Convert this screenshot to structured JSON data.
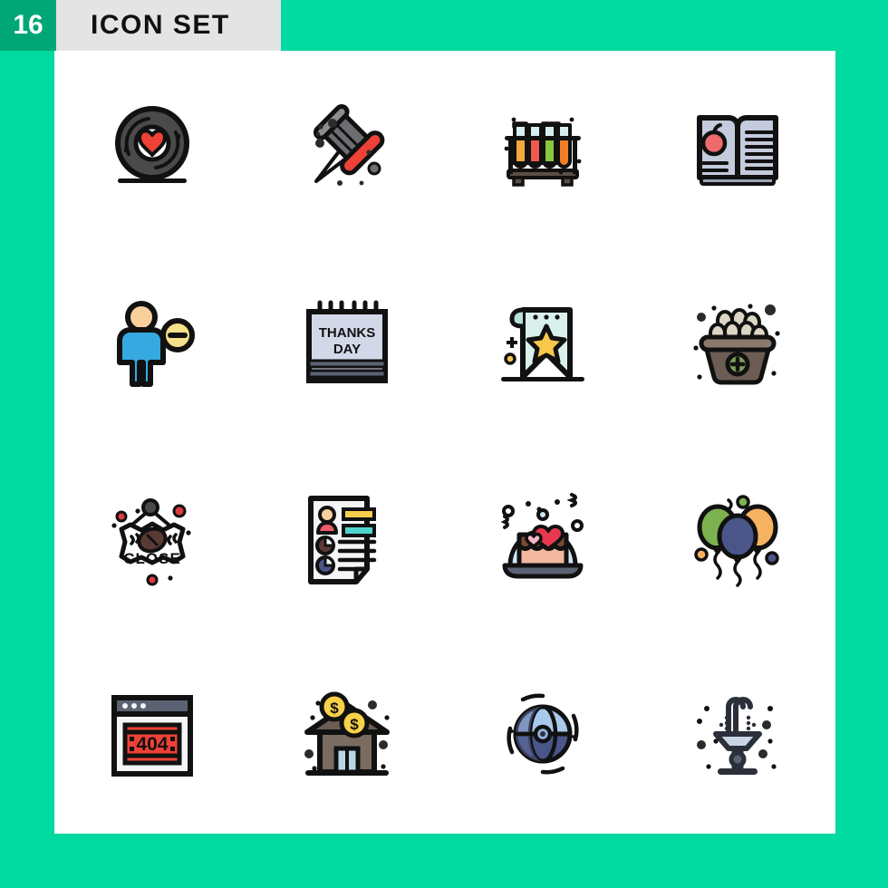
{
  "header": {
    "count": "16",
    "title": "ICON SET",
    "badge_color": "#00a776",
    "band_color": "#e4e4e4",
    "background_color": "#00d9a0",
    "panel_color": "#ffffff"
  },
  "grid": {
    "columns": 4,
    "rows": 4,
    "total_icons": 16
  },
  "icons": [
    {
      "id": "vinyl-record-heart",
      "label": "Vinyl Record Heart",
      "row": 1,
      "col": 1,
      "colors": {
        "primary": "#4a4a4a",
        "accent": "#ef4136",
        "outline": "#111111"
      }
    },
    {
      "id": "push-pin",
      "label": "Push Pin",
      "row": 1,
      "col": 2,
      "colors": {
        "primary": "#6d6e71",
        "accent": "#ef4136",
        "outline": "#111111"
      }
    },
    {
      "id": "test-tube-rack",
      "label": "Test Tube Rack",
      "row": 1,
      "col": 3,
      "colors": {
        "tube1": "#f4a93c",
        "tube2": "#ef5a4c",
        "tube3": "#8cc63f",
        "tube4": "#f07d29",
        "glass": "#d7eef0",
        "outline": "#111111"
      }
    },
    {
      "id": "open-book-apple",
      "label": "Open Book Apple",
      "row": 1,
      "col": 4,
      "colors": {
        "page": "#c3cbdc",
        "accent": "#ef6b6b",
        "outline": "#111111"
      }
    },
    {
      "id": "remove-user",
      "label": "Remove User",
      "row": 2,
      "col": 1,
      "colors": {
        "body": "#36a9e1",
        "skin": "#f9cf9c",
        "badge": "#f7e08a",
        "outline": "#111111"
      }
    },
    {
      "id": "thanks-day-calendar",
      "label": "Thanks Day Calendar",
      "row": 2,
      "col": 2,
      "text": {
        "line1": "THANKS",
        "line2": "DAY"
      },
      "colors": {
        "page": "#d3d8e8",
        "band": "#5b6273",
        "outline": "#111111"
      }
    },
    {
      "id": "star-banner",
      "label": "Star Banner",
      "row": 2,
      "col": 3,
      "colors": {
        "cloth": "#d9f0ec",
        "star": "#f8c84b",
        "outline": "#111111"
      }
    },
    {
      "id": "egg-basket",
      "label": "Egg Basket",
      "row": 2,
      "col": 4,
      "colors": {
        "basket": "#6b5d53",
        "egg": "#ddd6c4",
        "badge": "#7fa05a",
        "outline": "#111111"
      }
    },
    {
      "id": "close-sign",
      "label": "Close Sign",
      "row": 3,
      "col": 1,
      "text": {
        "label": "CLOSE"
      },
      "colors": {
        "bean": "#5a3a33",
        "dot": "#e03a3e",
        "outline": "#111111"
      }
    },
    {
      "id": "resume-document",
      "label": "Resume Document",
      "row": 3,
      "col": 2,
      "colors": {
        "paper": "#f4f5f7",
        "bar1": "#f8cf4e",
        "bar2": "#4fd4cd",
        "avatar": "#ef5a6b",
        "skin": "#f9cf9c",
        "outline": "#111111"
      }
    },
    {
      "id": "cake-glass-dome",
      "label": "Cake Glass Dome",
      "row": 3,
      "col": 3,
      "colors": {
        "dome": "#cfe7f5",
        "frosting": "#7a4a32",
        "cake": "#f2b9a0",
        "heart": "#e8384f",
        "tray": "#5b6273",
        "outline": "#111111"
      }
    },
    {
      "id": "party-balloons",
      "label": "Party Balloons",
      "row": 3,
      "col": 4,
      "colors": {
        "green": "#7cb24f",
        "blue": "#4a5689",
        "orange": "#f6b161",
        "outline": "#111111"
      }
    },
    {
      "id": "browser-404-error",
      "label": "Browser 404 Error",
      "row": 4,
      "col": 1,
      "text": {
        "code": "404"
      },
      "colors": {
        "titlebar": "#5b6273",
        "page": "#f4f5f7",
        "error": "#ef4136",
        "outline": "#111111"
      }
    },
    {
      "id": "house-money",
      "label": "House Money",
      "row": 4,
      "col": 2,
      "colors": {
        "roof": "#6b5d53",
        "wall": "#7a6c61",
        "coin": "#f8d148",
        "door": "#b6d6e4",
        "outline": "#111111"
      }
    },
    {
      "id": "global-network",
      "label": "Global Network",
      "row": 4,
      "col": 3,
      "colors": {
        "light": "#a8c9ec",
        "dark": "#4a5689",
        "outline": "#111111"
      }
    },
    {
      "id": "water-fountain",
      "label": "Water Fountain",
      "row": 4,
      "col": 4,
      "colors": {
        "basin": "#c9d4e4",
        "post": "#2b2f3a",
        "outline": "#111111"
      }
    }
  ]
}
